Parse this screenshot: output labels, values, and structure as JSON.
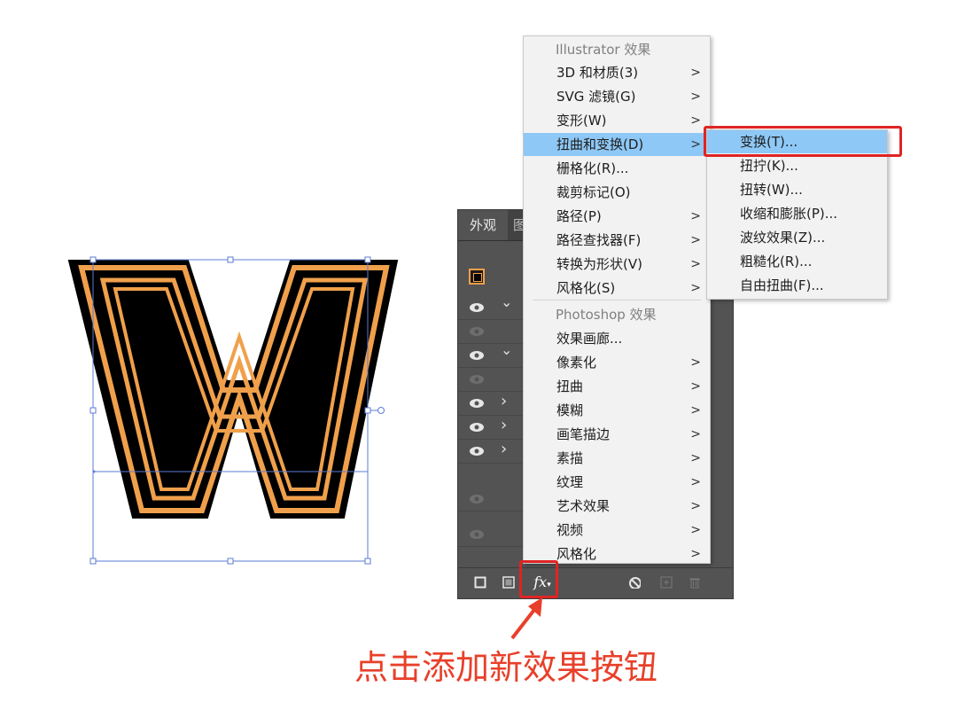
{
  "effect_menu": {
    "illustrator_header": "Illustrator 效果",
    "photoshop_header": "Photoshop 效果",
    "illustrator_items": [
      {
        "label": "3D 和材质(3)",
        "submenu": true
      },
      {
        "label": "SVG 滤镜(G)",
        "submenu": true
      },
      {
        "label": "变形(W)",
        "submenu": true
      },
      {
        "label": "扭曲和变换(D)",
        "submenu": true,
        "highlighted": true
      },
      {
        "label": "栅格化(R)...",
        "submenu": false
      },
      {
        "label": "裁剪标记(O)",
        "submenu": false
      },
      {
        "label": "路径(P)",
        "submenu": true
      },
      {
        "label": "路径查找器(F)",
        "submenu": true
      },
      {
        "label": "转换为形状(V)",
        "submenu": true
      },
      {
        "label": "风格化(S)",
        "submenu": true
      }
    ],
    "photoshop_items": [
      {
        "label": "效果画廊...",
        "submenu": false
      },
      {
        "label": "像素化",
        "submenu": true
      },
      {
        "label": "扭曲",
        "submenu": true
      },
      {
        "label": "模糊",
        "submenu": true
      },
      {
        "label": "画笔描边",
        "submenu": true
      },
      {
        "label": "素描",
        "submenu": true
      },
      {
        "label": "纹理",
        "submenu": true
      },
      {
        "label": "艺术效果",
        "submenu": true
      },
      {
        "label": "视频",
        "submenu": true
      },
      {
        "label": "风格化",
        "submenu": true
      }
    ],
    "arrow_glyph": ">"
  },
  "submenu": {
    "items": [
      {
        "label": "变换(T)...",
        "highlighted": true
      },
      {
        "label": "扭拧(K)..."
      },
      {
        "label": "扭转(W)..."
      },
      {
        "label": "收缩和膨胀(P)..."
      },
      {
        "label": "波纹效果(Z)..."
      },
      {
        "label": "粗糙化(R)..."
      },
      {
        "label": "自由扭曲(F)..."
      }
    ]
  },
  "appearance_panel": {
    "tab_appearance": "外观",
    "tab_partial": "图",
    "fx_button": "fx",
    "rows": [
      {
        "visible": true,
        "expand": "down"
      },
      {
        "visible": false,
        "expand": ""
      },
      {
        "visible": true,
        "expand": "down"
      },
      {
        "visible": false,
        "expand": ""
      },
      {
        "visible": true,
        "expand": "right"
      },
      {
        "visible": true,
        "expand": "right"
      },
      {
        "visible": true,
        "expand": "right"
      },
      {
        "visible": false,
        "expand": ""
      },
      {
        "visible": false,
        "expand": ""
      }
    ]
  },
  "annotation": {
    "caption": "点击添加新效果按钮"
  },
  "colors": {
    "menu_highlight": "#8ec8f6",
    "annotation_red": "#e02424",
    "stroke_orange": "#f0a04b",
    "panel_gray": "#535353"
  }
}
